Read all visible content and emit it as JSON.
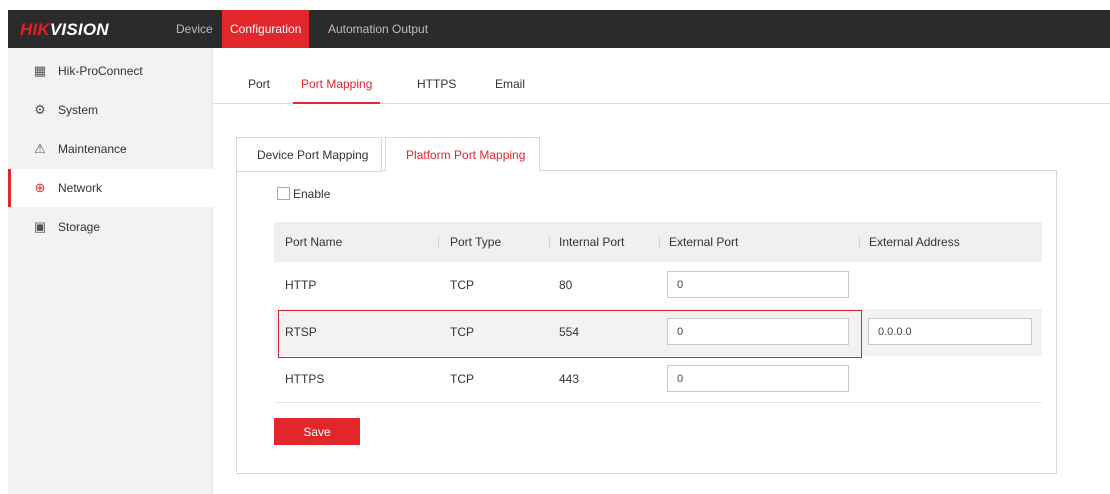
{
  "brand": {
    "hik": "HIK",
    "vision": "VISION"
  },
  "topnav": {
    "items": [
      {
        "label": "Device"
      },
      {
        "label": "Configuration"
      },
      {
        "label": "Automation Output"
      }
    ]
  },
  "sidebar": {
    "items": [
      {
        "label": "Hik-ProConnect",
        "icon": "building-icon"
      },
      {
        "label": "System",
        "icon": "gear-icon"
      },
      {
        "label": "Maintenance",
        "icon": "maintenance-icon"
      },
      {
        "label": "Network",
        "icon": "globe-icon"
      },
      {
        "label": "Storage",
        "icon": "floppy-icon"
      }
    ],
    "active": "Network"
  },
  "subtabs": {
    "items": [
      {
        "label": "Port"
      },
      {
        "label": "Port Mapping"
      },
      {
        "label": "HTTPS"
      },
      {
        "label": "Email"
      }
    ],
    "active": "Port Mapping"
  },
  "panel_tabs": {
    "items": [
      {
        "label": "Device Port Mapping"
      },
      {
        "label": "Platform Port Mapping"
      }
    ],
    "active": "Platform Port Mapping"
  },
  "enable": {
    "label": "Enable",
    "checked": false
  },
  "table": {
    "headers": [
      "Port Name",
      "Port Type",
      "Internal Port",
      "External Port",
      "External Address"
    ],
    "rows": [
      {
        "name": "HTTP",
        "type": "TCP",
        "internal": "80",
        "external": "0",
        "address": ""
      },
      {
        "name": "RTSP",
        "type": "TCP",
        "internal": "554",
        "external": "0",
        "address": "0.0.0.0"
      },
      {
        "name": "HTTPS",
        "type": "TCP",
        "internal": "443",
        "external": "0",
        "address": ""
      }
    ]
  },
  "save_label": "Save",
  "colors": {
    "accent": "#e1262c",
    "topbar": "#2b2b2b",
    "sidebar": "#f2f2f2"
  }
}
